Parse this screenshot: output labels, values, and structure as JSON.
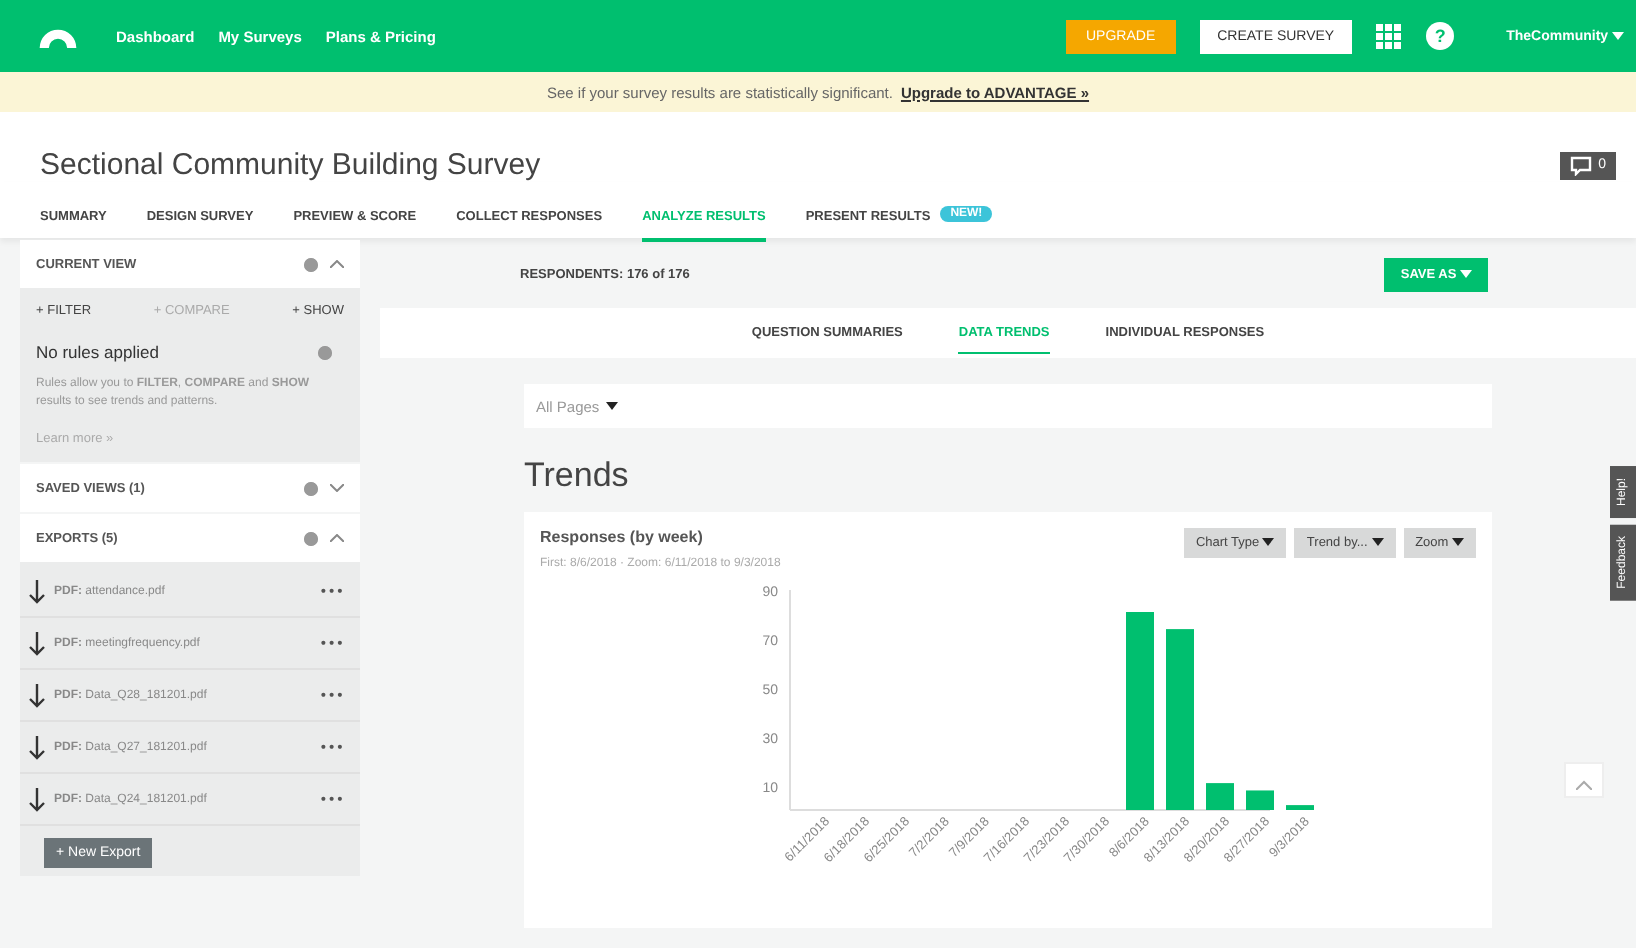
{
  "topnav": {
    "links": [
      "Dashboard",
      "My Surveys",
      "Plans & Pricing"
    ],
    "upgrade": "UPGRADE",
    "create": "CREATE SURVEY",
    "help": "?",
    "account": "TheCommunity"
  },
  "banner": {
    "text": "See if your survey results are statistically significant.",
    "link": "Upgrade to ADVANTAGE »"
  },
  "survey_title": "Sectional Community Building Survey",
  "comments": "0",
  "tabs": [
    {
      "label": "SUMMARY",
      "selected": false
    },
    {
      "label": "DESIGN SURVEY",
      "selected": false
    },
    {
      "label": "PREVIEW & SCORE",
      "selected": false
    },
    {
      "label": "COLLECT RESPONSES",
      "selected": false
    },
    {
      "label": "ANALYZE RESULTS",
      "selected": true
    },
    {
      "label": "PRESENT RESULTS",
      "selected": false,
      "badge": "NEW!"
    }
  ],
  "sidebar": {
    "current_view": {
      "title": "CURRENT VIEW",
      "expanded": true,
      "actions": [
        {
          "label": "+ FILTER",
          "disabled": false
        },
        {
          "label": "+ COMPARE",
          "disabled": true
        },
        {
          "label": "+ SHOW",
          "disabled": false
        }
      ],
      "rules_title": "No rules applied",
      "description": "Rules allow you to **FILTER**, **COMPARE** and **SHOW** results to see trends and patterns.",
      "learn_more": "Learn more »"
    },
    "saved_views": {
      "title": "SAVED VIEWS (1)",
      "expanded": false
    },
    "exports": {
      "title": "EXPORTS (5)",
      "expanded": true,
      "items": [
        {
          "type": "PDF:",
          "file": "attendance.pdf"
        },
        {
          "type": "PDF:",
          "file": "meetingfrequency.pdf"
        },
        {
          "type": "PDF:",
          "file": "Data_Q28_181201.pdf"
        },
        {
          "type": "PDF:",
          "file": "Data_Q27_181201.pdf"
        },
        {
          "type": "PDF:",
          "file": "Data_Q24_181201.pdf"
        }
      ],
      "more": "•••",
      "new_button": "+ New Export"
    }
  },
  "main": {
    "respondents": "RESPONDENTS: 176 of 176",
    "save_as": "SAVE AS",
    "subtabs": [
      {
        "label": "QUESTION SUMMARIES",
        "selected": false
      },
      {
        "label": "DATA TRENDS",
        "selected": true
      },
      {
        "label": "INDIVIDUAL RESPONSES",
        "selected": false
      }
    ],
    "pages_dropdown": "All Pages",
    "heading": "Trends",
    "chart_card": {
      "title": "Responses (by week)",
      "subtitle": "First: 8/6/2018 · Zoom: 6/11/2018 to 9/3/2018",
      "buttons": [
        "Chart Type",
        "Trend by...",
        "Zoom"
      ],
      "chart_data": {
        "type": "bar",
        "categories": [
          "6/11/2018",
          "6/18/2018",
          "6/25/2018",
          "7/2/2018",
          "7/9/2018",
          "7/16/2018",
          "7/23/2018",
          "7/30/2018",
          "8/6/2018",
          "8/13/2018",
          "8/20/2018",
          "8/27/2018",
          "9/3/2018"
        ],
        "series": [
          {
            "color": "#00bf6f",
            "values": [
              0,
              0,
              0,
              0,
              0,
              0,
              0,
              0,
              81,
              74,
              11,
              8,
              2
            ]
          }
        ],
        "ylim": [
          0,
          90
        ],
        "yticks": [
          10,
          30,
          50,
          70,
          90
        ]
      }
    }
  },
  "side_tabs": [
    "Help!",
    "Feedback"
  ]
}
